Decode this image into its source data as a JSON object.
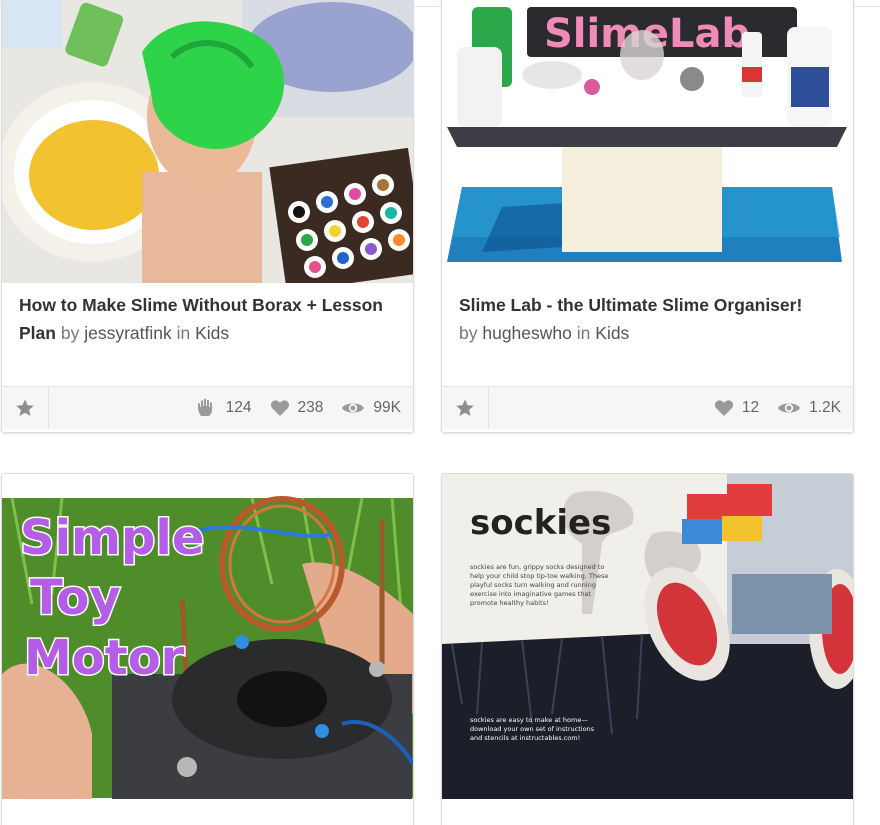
{
  "cards": [
    {
      "title": "How to Make Slime Without Borax + Lesson Plan",
      "by_label": "by",
      "author": "jessyratfink",
      "in_label": "in",
      "category": "Kids",
      "stats": {
        "made": "124",
        "favorites": "238",
        "views": "99K"
      },
      "image_icon": "slime-photo"
    },
    {
      "title": "Slime Lab - the Ultimate Slime Organiser!",
      "by_label": "by",
      "author": "hugheswho",
      "in_label": "in",
      "category": "Kids",
      "stats": {
        "favorites": "12",
        "views": "1.2K"
      },
      "image_text": "SlimeLab",
      "image_icon": "slime-lab-photo"
    },
    {
      "image_text": [
        "Simple",
        "Toy",
        "Motor"
      ],
      "image_icon": "toy-motor-photo"
    },
    {
      "image_text": {
        "brand": "sockies",
        "blurb_top": [
          "sockies are fun, grippy socks designed to",
          "help your child stop tip-toe walking. These",
          "playful socks turn walking and running",
          "exercise into imaginative games that",
          "promote healthy habits!"
        ],
        "blurb_bottom": [
          "sockies are easy to make at home—",
          "download your own set of instructions",
          "and stencils at instructables.com!"
        ]
      },
      "image_icon": "sockies-photo"
    }
  ],
  "icons": {
    "favorite": "star-icon",
    "made": "hand-icon",
    "likes": "heart-icon",
    "views": "eye-icon"
  },
  "colors": {
    "star": "#8e8e8e",
    "stat_icon": "#9a9a9a",
    "footer_bg": "#f6f6f6"
  }
}
